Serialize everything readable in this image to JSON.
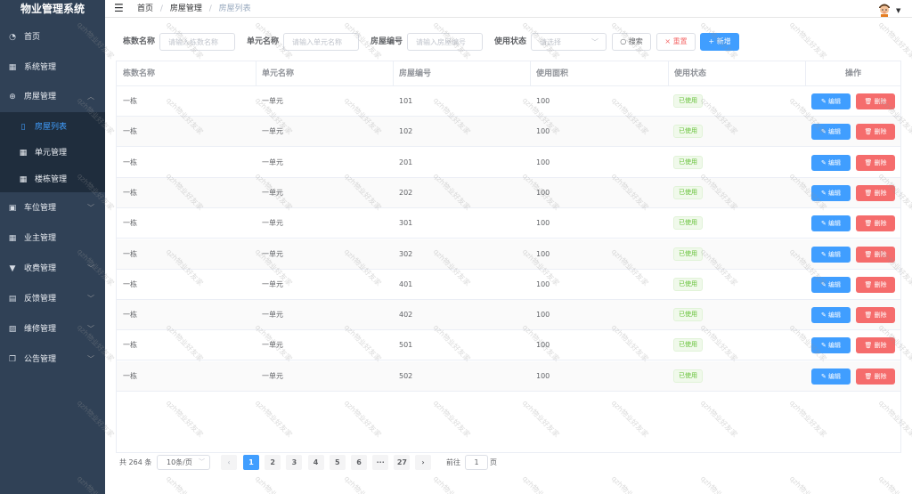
{
  "app": {
    "title": "物业管理系统"
  },
  "sidebar": {
    "items": [
      {
        "label": "首页",
        "icon": "dashboard-icon",
        "chevron": ""
      },
      {
        "label": "系统管理",
        "icon": "grid-icon",
        "chevron": ""
      },
      {
        "label": "房屋管理",
        "icon": "plus-circle-icon",
        "chevron": "︿"
      },
      {
        "label": "车位管理",
        "icon": "parking-icon",
        "chevron": "﹀"
      },
      {
        "label": "业主管理",
        "icon": "grid-icon",
        "chevron": ""
      },
      {
        "label": "收费管理",
        "icon": "money-icon",
        "chevron": "﹀"
      },
      {
        "label": "反馈管理",
        "icon": "calendar-icon",
        "chevron": "﹀"
      },
      {
        "label": "维修管理",
        "icon": "picture-icon",
        "chevron": "﹀"
      },
      {
        "label": "公告管理",
        "icon": "copy-icon",
        "chevron": "﹀"
      }
    ],
    "submenu": [
      {
        "label": "房屋列表",
        "active": true
      },
      {
        "label": "单元管理",
        "active": false
      },
      {
        "label": "楼栋管理",
        "active": false
      }
    ]
  },
  "header": {
    "breadcrumb": [
      "首页",
      "房屋管理",
      "房屋列表"
    ],
    "separator": "/"
  },
  "filters": {
    "building_label": "栋数名称",
    "building_placeholder": "请输入栋数名称",
    "unit_label": "单元名称",
    "unit_placeholder": "请输入单元名称",
    "house_label": "房屋编号",
    "house_placeholder": "请输入房屋编号",
    "status_label": "使用状态",
    "status_placeholder": "请选择",
    "search_button": "搜索",
    "reset_button": "重置",
    "add_button": "新增"
  },
  "table": {
    "columns": [
      "栋数名称",
      "单元名称",
      "房屋编号",
      "使用面积",
      "使用状态",
      "操作"
    ],
    "rows": [
      {
        "building": "一栋",
        "unit": "一单元",
        "house_no": "101",
        "area": "100",
        "status": "已使用"
      },
      {
        "building": "一栋",
        "unit": "一单元",
        "house_no": "102",
        "area": "100",
        "status": "已使用"
      },
      {
        "building": "一栋",
        "unit": "一单元",
        "house_no": "201",
        "area": "100",
        "status": "已使用"
      },
      {
        "building": "一栋",
        "unit": "一单元",
        "house_no": "202",
        "area": "100",
        "status": "已使用"
      },
      {
        "building": "一栋",
        "unit": "一单元",
        "house_no": "301",
        "area": "100",
        "status": "已使用"
      },
      {
        "building": "一栋",
        "unit": "一单元",
        "house_no": "302",
        "area": "100",
        "status": "已使用"
      },
      {
        "building": "一栋",
        "unit": "一单元",
        "house_no": "401",
        "area": "100",
        "status": "已使用"
      },
      {
        "building": "一栋",
        "unit": "一单元",
        "house_no": "402",
        "area": "100",
        "status": "已使用"
      },
      {
        "building": "一栋",
        "unit": "一单元",
        "house_no": "501",
        "area": "100",
        "status": "已使用"
      },
      {
        "building": "一栋",
        "unit": "一单元",
        "house_no": "502",
        "area": "100",
        "status": "已使用"
      }
    ],
    "edit_label": "编辑",
    "delete_label": "删除"
  },
  "pagination": {
    "total_text": "共 264 条",
    "page_size": "10条/页",
    "prev": "‹",
    "pages": [
      "1",
      "2",
      "3",
      "4",
      "5",
      "6",
      "···",
      "27"
    ],
    "current": "1",
    "next": "›",
    "goto_label": "前往",
    "goto_value": "1",
    "goto_suffix": "页"
  },
  "watermark": {
    "text": "qzh物业好友家"
  },
  "colors": {
    "sidebar_bg": "#304156",
    "submenu_bg": "#1f2d3d",
    "primary": "#409eff",
    "danger": "#f56c6c",
    "success": "#67c23a"
  }
}
